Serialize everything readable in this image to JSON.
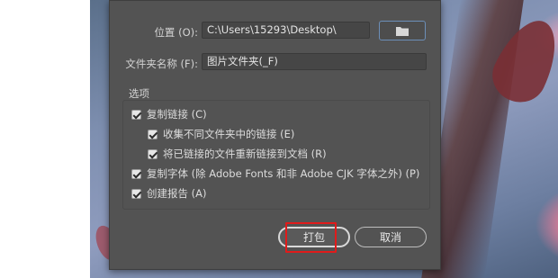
{
  "dialog": {
    "location": {
      "label": "位置 (O):",
      "value": "C:\\Users\\15293\\Desktop\\"
    },
    "folder_name": {
      "label": "文件夹名称 (F):",
      "value": "图片文件夹(_F)"
    },
    "options": {
      "title": "选项",
      "items": [
        {
          "label": "复制链接 (C)",
          "checked": true
        },
        {
          "label": "收集不同文件夹中的链接 (E)",
          "checked": true
        },
        {
          "label": "将已链接的文件重新链接到文档 (R)",
          "checked": true
        },
        {
          "label": "复制字体 (除 Adobe Fonts 和非 Adobe CJK 字体之外) (P)",
          "checked": true
        },
        {
          "label": "创建报告 (A)",
          "checked": true
        }
      ]
    },
    "buttons": {
      "package": "打包",
      "cancel": "取消"
    }
  },
  "colors": {
    "dialog_bg": "#535353",
    "highlight": "#e01b1b",
    "focus_border": "#6c8fb8"
  },
  "icons": {
    "browse": "folder-icon"
  }
}
